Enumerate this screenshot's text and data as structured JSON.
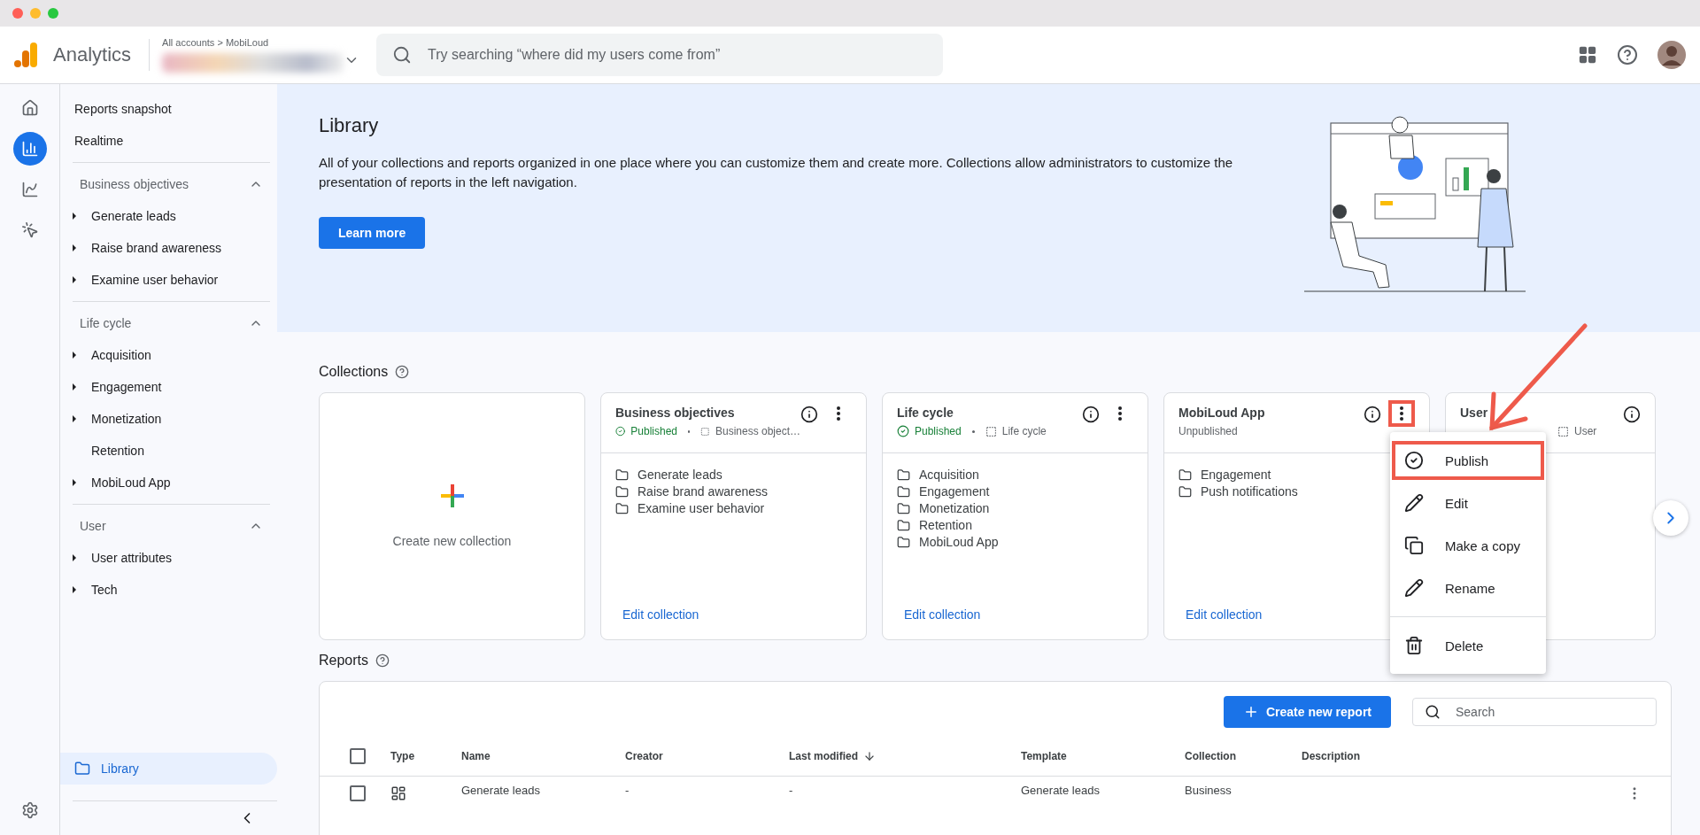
{
  "header": {
    "product": "Analytics",
    "breadcrumb": "All accounts > MobiLoud",
    "search": {
      "placeholder": "Try searching “where did my users come from”"
    }
  },
  "rail": [
    {
      "selected": false
    },
    {
      "selected": true
    },
    {
      "selected": false
    },
    {
      "selected": false
    }
  ],
  "sidebar": {
    "nav": [
      {
        "kind": "link",
        "label": "Reports snapshot",
        "selected": false
      },
      {
        "kind": "link",
        "label": "Realtime",
        "selected": false
      },
      {
        "kind": "section",
        "title": "Business objectives",
        "expanded": true,
        "items": [
          {
            "label": "Generate leads",
            "expandable": true,
            "selected": false
          },
          {
            "label": "Raise brand awareness",
            "expandable": true,
            "selected": false
          },
          {
            "label": "Examine user behavior",
            "expandable": true,
            "selected": false
          }
        ]
      },
      {
        "kind": "section",
        "title": "Life cycle",
        "expanded": true,
        "items": [
          {
            "label": "Acquisition",
            "expandable": true,
            "selected": false
          },
          {
            "label": "Engagement",
            "expandable": true,
            "selected": false
          },
          {
            "label": "Monetization",
            "expandable": true,
            "selected": false
          },
          {
            "label": "Retention",
            "expandable": false,
            "selected": false
          },
          {
            "label": "MobiLoud App",
            "expandable": true,
            "selected": false
          }
        ]
      },
      {
        "kind": "section",
        "title": "User",
        "expanded": true,
        "items": [
          {
            "label": "User attributes",
            "expandable": true,
            "selected": false
          },
          {
            "label": "Tech",
            "expandable": true,
            "selected": false
          }
        ]
      }
    ],
    "library": {
      "label": "Library",
      "selected": true
    }
  },
  "banner": {
    "title": "Library",
    "text": "All of your collections and reports organized in one place where you can customize them and create more. Collections allow administrators to customize the presentation of reports in the left navigation.",
    "button": "Learn more"
  },
  "collections": {
    "title": "Collections",
    "cards": [
      {
        "kind": "create",
        "label": "Create new collection"
      },
      {
        "kind": "collection",
        "title": "Business objectives",
        "status": "Published",
        "published": true,
        "template": "Business object…",
        "folders": [
          "Generate leads",
          "Raise brand awareness",
          "Examine user behavior"
        ],
        "link": "Edit collection",
        "menu_highlighted": false
      },
      {
        "kind": "collection",
        "title": "Life cycle",
        "status": "Published",
        "published": true,
        "template": "Life cycle",
        "folders": [
          "Acquisition",
          "Engagement",
          "Monetization",
          "Retention",
          "MobiLoud App"
        ],
        "link": "Edit collection",
        "menu_highlighted": false
      },
      {
        "kind": "collection",
        "title": "MobiLoud App",
        "status": "Unpublished",
        "published": false,
        "folders": [
          "Engagement",
          "Push notifications"
        ],
        "link": "Edit collection",
        "menu_highlighted": true
      },
      {
        "kind": "partial",
        "title": "User",
        "template": "User"
      }
    ],
    "menu": [
      {
        "label": "Publish",
        "highlighted": true
      },
      {
        "label": "Edit",
        "highlighted": false
      },
      {
        "label": "Make a copy",
        "highlighted": false
      },
      {
        "label": "Rename",
        "highlighted": false
      },
      {
        "label": "Delete",
        "highlighted": false
      }
    ]
  },
  "reports": {
    "title": "Reports",
    "create_button": "Create new report",
    "search": {
      "placeholder": "Search"
    },
    "columns": [
      {
        "label": "Type",
        "sorted": false
      },
      {
        "label": "Name",
        "sorted": false
      },
      {
        "label": "Creator",
        "sorted": false
      },
      {
        "label": "Last modified",
        "sorted": true
      },
      {
        "label": "Template",
        "sorted": false
      },
      {
        "label": "Collection",
        "sorted": false
      },
      {
        "label": "Description",
        "sorted": false
      }
    ],
    "select_all_checked": false,
    "rows": [
      {
        "checked": false,
        "cells": [
          "",
          "Generate leads",
          "-",
          "-",
          "Generate leads",
          "Business",
          ""
        ]
      }
    ]
  }
}
